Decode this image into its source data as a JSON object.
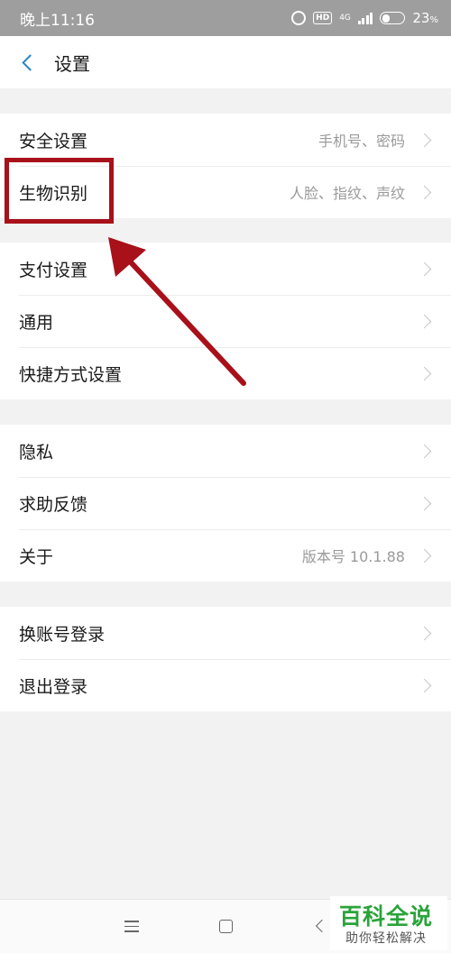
{
  "status_bar": {
    "time": "晚上11:16",
    "hd_label": "HD",
    "network_label": "4G",
    "battery_percent": "23",
    "battery_unit": "%"
  },
  "header": {
    "title": "设置"
  },
  "groups": [
    {
      "items": [
        {
          "label": "安全设置",
          "value": "手机号、密码"
        },
        {
          "label": "生物识别",
          "value": "人脸、指纹、声纹"
        }
      ]
    },
    {
      "items": [
        {
          "label": "支付设置"
        },
        {
          "label": "通用"
        },
        {
          "label": "快捷方式设置"
        }
      ]
    },
    {
      "items": [
        {
          "label": "隐私"
        },
        {
          "label": "求助反馈"
        },
        {
          "label": "关于",
          "value": "版本号 10.1.88"
        }
      ]
    },
    {
      "items": [
        {
          "label": "换账号登录"
        },
        {
          "label": "退出登录"
        }
      ]
    }
  ],
  "annotation": {
    "color": "#a8101a"
  },
  "watermark": {
    "main": "百科全说",
    "sub": "助你轻松解决"
  },
  "colors": {
    "accent": "#2a86c8",
    "watermark_green": "#2aa43a"
  }
}
